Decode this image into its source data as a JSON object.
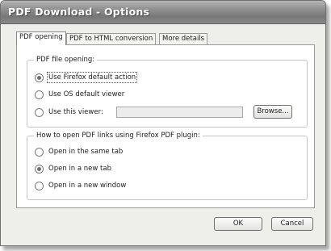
{
  "window": {
    "title": "PDF Download - Options"
  },
  "tabs": [
    {
      "label": "PDF opening",
      "active": true
    },
    {
      "label": "PDF to HTML conversion",
      "active": false
    },
    {
      "label": "More details",
      "active": false
    }
  ],
  "file_opening": {
    "legend": "PDF file opening:",
    "options": [
      {
        "label": "Use Firefox default action",
        "checked": true
      },
      {
        "label": "Use OS default viewer",
        "checked": false
      },
      {
        "label": "Use this viewer:",
        "checked": false
      }
    ],
    "viewer_path": "",
    "browse_label": "Browse..."
  },
  "links_opening": {
    "legend": "How to open PDF links using Firefox PDF plugin:",
    "options": [
      {
        "label": "Open in the same tab",
        "checked": false
      },
      {
        "label": "Open in a new tab",
        "checked": true
      },
      {
        "label": "Open in a new window",
        "checked": false
      }
    ]
  },
  "buttons": {
    "ok": "OK",
    "cancel": "Cancel"
  }
}
